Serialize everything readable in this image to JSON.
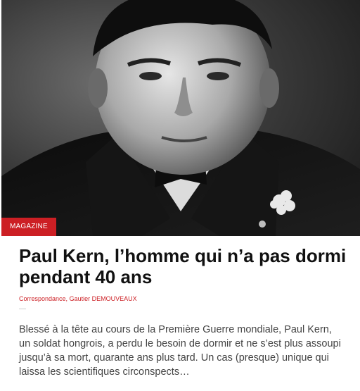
{
  "article": {
    "category": "MAGAZINE",
    "title": "Paul Kern, l’homme qui n’a pas dormi pendant 40 ans",
    "authors": [
      "Correspondance",
      "Gautier DEMOUVEAUX"
    ],
    "author_separator": ", ",
    "excerpt": "Blessé à la tête au cours de la Première Guerre mondiale, Paul Kern, un soldat hongrois, a perdu le besoin de dormir et ne s’est plus assoupi jusqu’à sa mort, quarante ans plus tard. Un cas (presque) unique qui laissa les scientifiques circonspects…"
  },
  "colors": {
    "accent": "#cc1f24",
    "title": "#111111",
    "excerpt": "#444444"
  }
}
